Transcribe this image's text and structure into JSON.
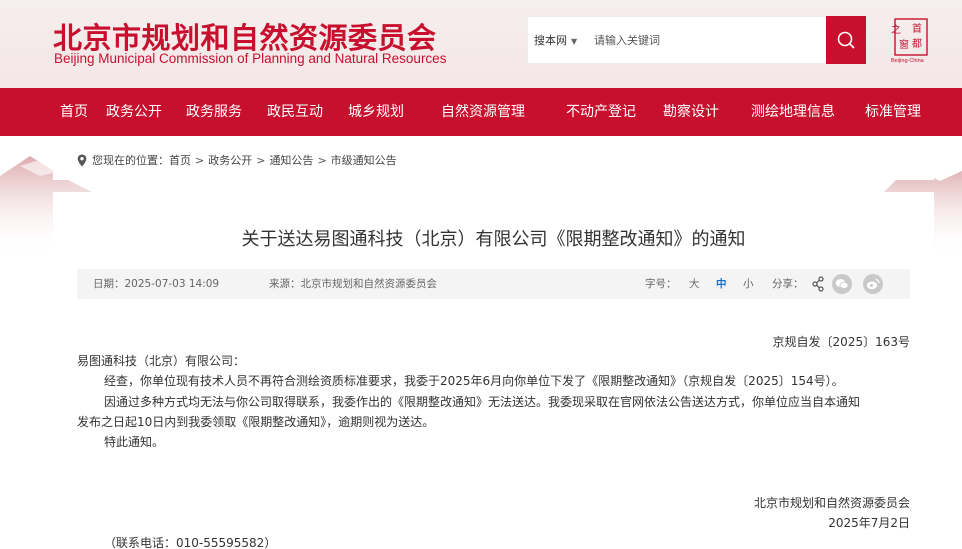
{
  "header": {
    "title_cn": "北京市规划和自然资源委员会",
    "title_en": "Beijing Municipal Commission of Planning and Natural Resources",
    "logo_chars": [
      "之",
      "首",
      "都",
      "窗"
    ],
    "logo_caption": "Beijing-China"
  },
  "search": {
    "scope": "搜本网",
    "placeholder": "请输入关键词"
  },
  "nav": {
    "items": [
      "首页",
      "政务公开",
      "政务服务",
      "政民互动",
      "城乡规划",
      "自然资源管理",
      "不动产登记",
      "勘察设计",
      "测绘地理信息",
      "标准管理"
    ]
  },
  "breadcrumb": {
    "prefix": "您现在的位置：",
    "items": [
      "首页",
      "政务公开",
      "通知公告",
      "市级通知公告"
    ],
    "separator": ">"
  },
  "article": {
    "title": "关于送达易图通科技（北京）有限公司《限期整改通知》的通知",
    "date": "日期：2025-07-03 14:09",
    "source": "来源：北京市规划和自然资源委员会",
    "font_size_label": "字号：",
    "font_sizes": [
      "大",
      "中",
      "小"
    ],
    "share_label": "分享：",
    "doc_number": "京规自发〔2025〕163号",
    "recipient": "易图通科技（北京）有限公司：",
    "paragraph1": "经查，你单位现有技术人员不再符合测绘资质标准要求，我委于2025年6月向你单位下发了《限期整改通知》（京规自发〔2025〕154号）。",
    "paragraph2_line1": "因通过多种方式均无法与你公司取得联系，我委作出的《限期整改通知》无法送达。我委现采取在官网依法公告送达方式，你单位应当自本通知",
    "paragraph2_line2": "发布之日起10日内到我委领取《限期整改通知》，逾期则视为送达。",
    "closing": "特此通知。",
    "signature": "北京市规划和自然资源委员会",
    "sign_date": "2025年7月2日",
    "contact": "（联系电话：010-55595582）"
  },
  "colors": {
    "brand_red": "#c8102e",
    "active_size": "#1a73c8"
  }
}
